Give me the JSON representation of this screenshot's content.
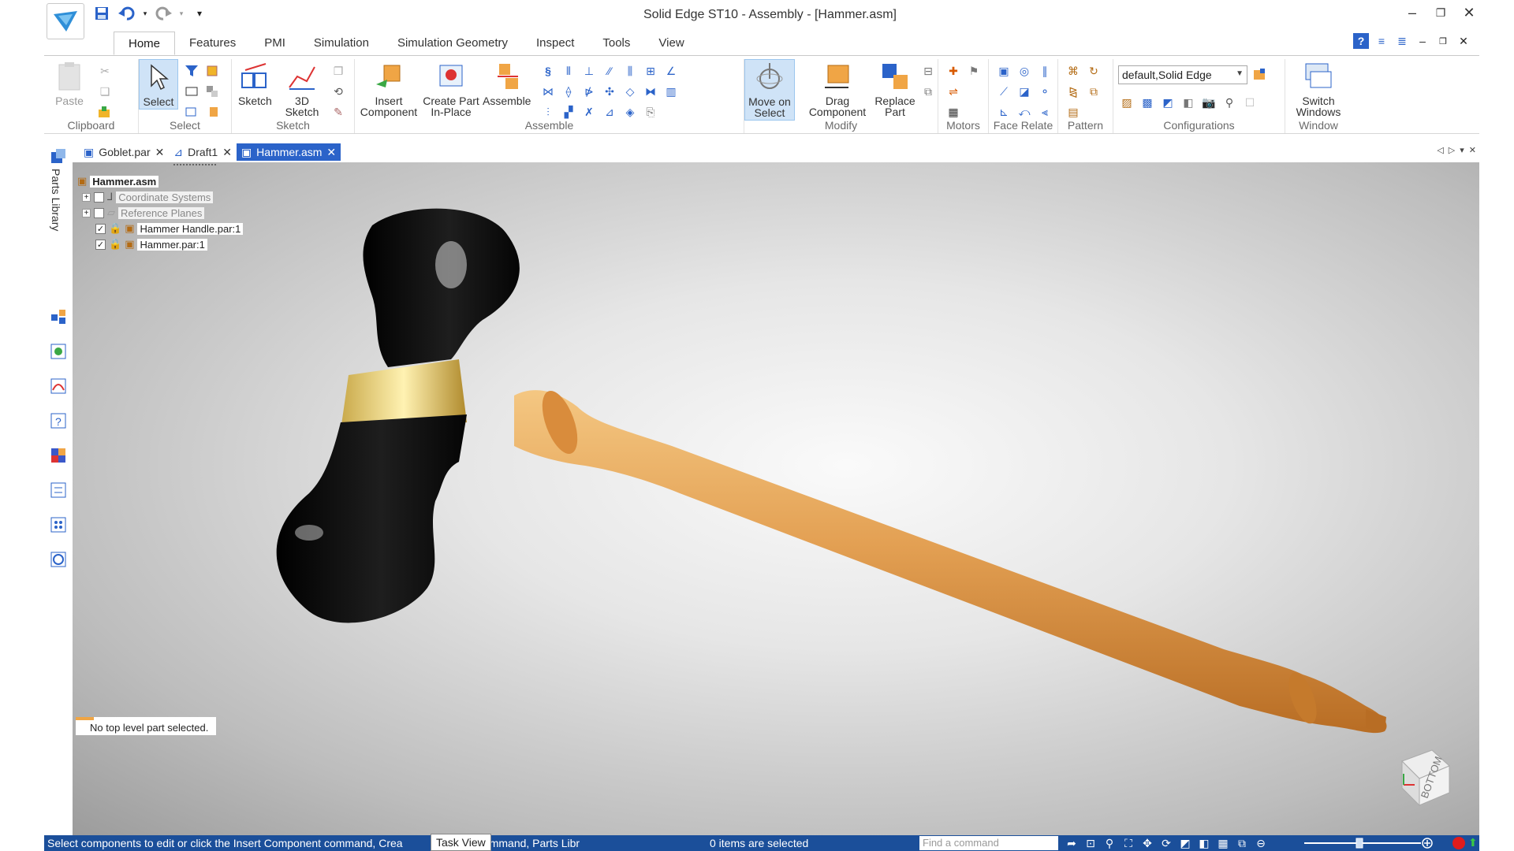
{
  "window": {
    "title": "Solid Edge ST10 - Assembly - [Hammer.asm]"
  },
  "ribbon_tabs": [
    "Home",
    "Features",
    "PMI",
    "Simulation",
    "Simulation Geometry",
    "Inspect",
    "Tools",
    "View"
  ],
  "ribbon": {
    "paste_label": "Paste",
    "select_label": "Select",
    "sketch_label": "Sketch",
    "sketch3d_label": "3D Sketch",
    "insert_component_label": "Insert Component",
    "create_part_label": "Create Part In-Place",
    "assemble_label": "Assemble",
    "move_on_select_label": "Move on Select",
    "drag_component_label": "Drag Component",
    "replace_part_label": "Replace Part",
    "switch_windows_label": "Switch Windows",
    "config_value": "default,Solid Edge",
    "groups": {
      "clipboard": "Clipboard",
      "select": "Select",
      "sketch": "Sketch",
      "assemble": "Assemble",
      "modify": "Modify",
      "motors": "Motors",
      "face_relate": "Face Relate",
      "pattern": "Pattern",
      "configurations": "Configurations",
      "window": "Window"
    }
  },
  "doc_tabs": [
    {
      "label": "Goblet.par"
    },
    {
      "label": "Draft1"
    },
    {
      "label": "Hammer.asm"
    }
  ],
  "left_panel": {
    "label": "Parts Library"
  },
  "tree": {
    "root": "Hammer.asm",
    "items": [
      {
        "label": "Coordinate Systems"
      },
      {
        "label": "Reference Planes"
      },
      {
        "label": "Hammer Handle.par:1"
      },
      {
        "label": "Hammer.par:1"
      }
    ]
  },
  "viewport": {
    "message": "No top level part selected.",
    "view_cube_label": "BOTTOM"
  },
  "status": {
    "prompt": "Select components to edit or click the Insert Component command, Crea",
    "prompt_tail": "lace command, Parts Libr",
    "task_view": "Task View",
    "selection": "0 items are selected",
    "find_placeholder": "Find a command"
  }
}
